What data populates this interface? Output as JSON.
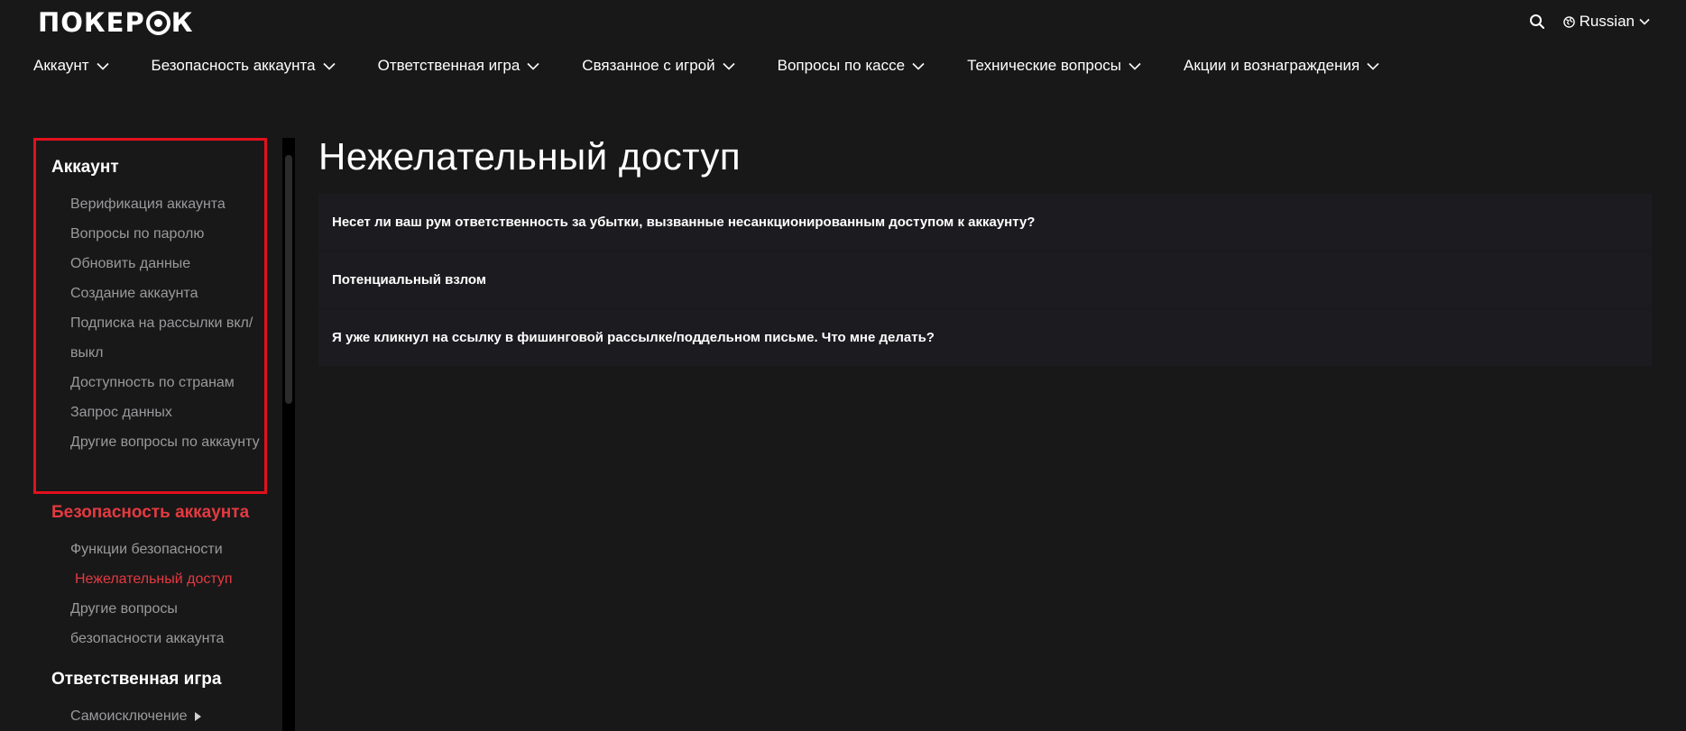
{
  "header": {
    "logo_text_left": "ПОКЕР",
    "logo_text_right": "К",
    "language": "Russian"
  },
  "topnav": [
    {
      "label": "Аккаунт"
    },
    {
      "label": "Безопасность аккаунта"
    },
    {
      "label": "Ответственная игра"
    },
    {
      "label": "Связанное с игрой"
    },
    {
      "label": "Вопросы по кассе"
    },
    {
      "label": "Технические вопросы"
    },
    {
      "label": "Акции и вознаграждения"
    }
  ],
  "sidebar": {
    "sections": [
      {
        "title": "Аккаунт",
        "items": [
          "Верификация аккаунта",
          "Вопросы по паролю",
          "Обновить данные",
          "Создание аккаунта",
          "Подписка на рассылки вкл/выкл",
          "Доступность по странам",
          "Запрос данных",
          "Другие вопросы по аккаунту"
        ]
      },
      {
        "title": "Безопасность аккаунта",
        "items": [
          "Функции безопасности",
          "Нежелательный доступ",
          "Другие вопросы безопасности аккаунта"
        ]
      },
      {
        "title": "Ответственная игра",
        "items": [
          "Самоисключение"
        ]
      }
    ]
  },
  "main": {
    "title": "Нежелательный доступ",
    "faqs": [
      "Несет ли ваш рум ответственность за убытки, вызванные несанкционированным доступом к аккаунту?",
      "Потенциальный взлом",
      "Я уже кликнул на ссылку в фишинговой рассылке/поддельном письме. Что мне делать?"
    ]
  },
  "colors": {
    "background": "#181819",
    "accent_red": "#e43a3f",
    "highlight_border": "#e3101d",
    "muted_text": "#9a9a9c"
  }
}
